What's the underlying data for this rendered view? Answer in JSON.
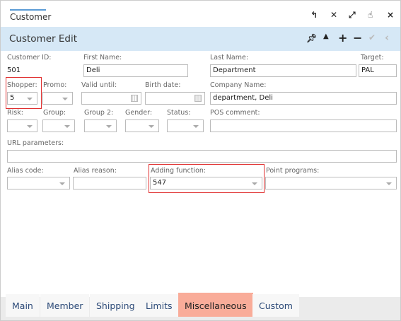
{
  "window": {
    "title": "Customer",
    "icons": [
      "undo-icon",
      "collapse-icon",
      "expand-icon",
      "pointer-icon",
      "close-icon"
    ]
  },
  "header": {
    "title": "Customer Edit",
    "icons": [
      "pin-icon",
      "caret-up-icon",
      "plus-icon",
      "minus-icon",
      "check-icon",
      "chevron-left-icon"
    ]
  },
  "form": {
    "customer_id": {
      "label": "Customer ID:",
      "value": "501"
    },
    "first_name": {
      "label": "First Name:",
      "value": "Deli"
    },
    "last_name": {
      "label": "Last Name:",
      "value": "Department"
    },
    "target": {
      "label": "Target:",
      "value": "PAL"
    },
    "shopper": {
      "label": "Shopper:",
      "value": "5"
    },
    "promo": {
      "label": "Promo:",
      "value": ""
    },
    "valid_until": {
      "label": "Valid until:",
      "value": ""
    },
    "birth_date": {
      "label": "Birth date:",
      "value": ""
    },
    "company_name": {
      "label": "Company Name:",
      "value": "department, Deli"
    },
    "risk": {
      "label": "Risk:",
      "value": ""
    },
    "group": {
      "label": "Group:",
      "value": ""
    },
    "group2": {
      "label": "Group 2:",
      "value": ""
    },
    "gender": {
      "label": "Gender:",
      "value": ""
    },
    "status": {
      "label": "Status:",
      "value": ""
    },
    "pos_comment": {
      "label": "POS comment:",
      "value": ""
    },
    "url_parameters": {
      "label": "URL parameters:",
      "value": ""
    },
    "alias_code": {
      "label": "Alias code:",
      "value": ""
    },
    "alias_reason": {
      "label": "Alias reason:",
      "value": ""
    },
    "adding_function": {
      "label": "Adding function:",
      "value": "547"
    },
    "point_programs": {
      "label": "Point programs:",
      "value": ""
    }
  },
  "tabs": [
    {
      "label": "Main"
    },
    {
      "label": "Member"
    },
    {
      "label": "Shipping"
    },
    {
      "label": "Limits"
    },
    {
      "label": "Miscellaneous",
      "active": true
    },
    {
      "label": "Custom"
    }
  ],
  "colors": {
    "header_bg": "#d6e8f6",
    "active_tab": "#f9ac99",
    "highlight": "#e03030"
  }
}
